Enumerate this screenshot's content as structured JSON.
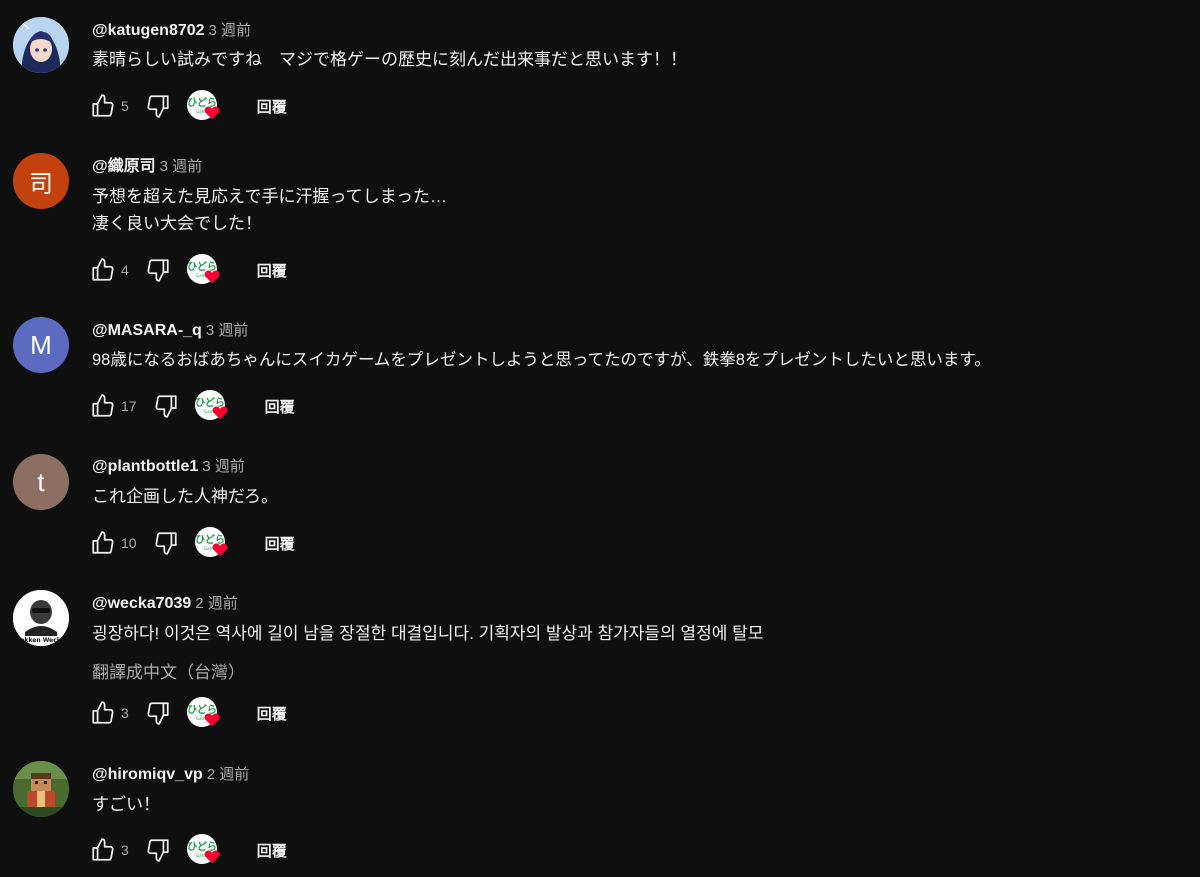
{
  "comments": [
    {
      "author": "@katugen8702",
      "time": "3 週前",
      "lines": [
        "素晴らしい試みですね　マジで格ゲーの歴史に刻んだ出来事だと思います！！"
      ],
      "likes": "5",
      "avatar_color": "#8fb4e6",
      "avatar_letter": ""
    },
    {
      "author": "@織原司",
      "time": "3 週前",
      "lines": [
        "予想を超えた見応えで手に汗握ってしまった…",
        "凄く良い大会でした！"
      ],
      "likes": "4",
      "avatar_color": "#c2410c",
      "avatar_letter": "司"
    },
    {
      "author": "@MASARA-_q",
      "time": "3 週前",
      "lines": [
        "98歳になるおばあちゃんにスイカゲームをプレゼントしようと思ってたのですが、鉄拳8をプレゼントしたいと思います。"
      ],
      "likes": "17",
      "avatar_color": "#5c6bc0",
      "avatar_letter": "M"
    },
    {
      "author": "@plantbottle1",
      "time": "3 週前",
      "lines": [
        "これ企画した人神だろ。"
      ],
      "likes": "10",
      "avatar_color": "#8d6e63",
      "avatar_letter": "t"
    },
    {
      "author": "@wecka7039",
      "time": "2 週前",
      "lines": [
        "굉장하다! 이것은 역사에 길이 남을 장절한 대결입니다. 기획자의 발상과 참가자들의 열정에 탈모"
      ],
      "translate": "翻譯成中文（台灣）",
      "likes": "3",
      "avatar_color": "#ffffff",
      "avatar_letter": ""
    },
    {
      "author": "@hiromiqv_vp",
      "time": "2 週前",
      "lines": [
        "すごい！"
      ],
      "likes": "3",
      "avatar_color": "#3d5a2a",
      "avatar_letter": ""
    }
  ],
  "ui": {
    "reply_label": "回覆",
    "creator_logo_text": "ひどら",
    "wecka_avatar_text": "Tekken Wecka"
  },
  "icons": {
    "like": "thumbs-up-icon",
    "dislike": "thumbs-down-icon",
    "heart": "heart-icon"
  },
  "colors": {
    "background": "#0f0f0f",
    "primary_text": "#f1f1f1",
    "secondary_text": "#aaaaaa",
    "heart": "#ff0033",
    "creator_logo_green": "#1e9e4a"
  }
}
